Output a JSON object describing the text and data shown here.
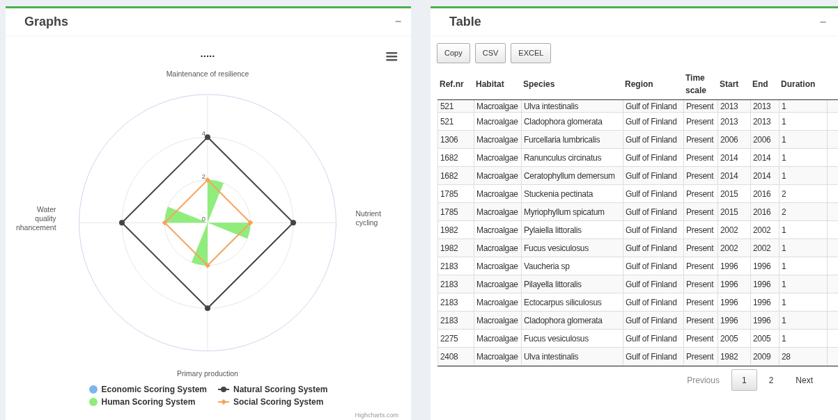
{
  "graphs_panel": {
    "title": "Graphs",
    "collapse": "−",
    "chart": {
      "title": ".....",
      "axis_labels": [
        "Maintenance of resilience",
        "Nutrient cycling",
        "Primary production",
        "Water quality nhancement"
      ],
      "tick_labels": [
        "4",
        "2",
        "0"
      ],
      "legend": [
        {
          "name": "Economic Scoring System",
          "color": "#7cb5ec",
          "kind": "dot"
        },
        {
          "name": "Natural Scoring System",
          "color": "#434348",
          "kind": "line-circle"
        },
        {
          "name": "Human Scoring System",
          "color": "#90ed7d",
          "kind": "dot"
        },
        {
          "name": "Social Scoring System",
          "color": "#f7a35c",
          "kind": "line-diamond"
        }
      ]
    },
    "credit": "Highcharts.com"
  },
  "table_panel": {
    "title": "Table",
    "collapse": "−",
    "buttons": [
      "Copy",
      "CSV",
      "EXCEL"
    ],
    "columns": [
      "Ref.nr",
      "Habitat",
      "Species",
      "Region",
      "Time scale",
      "Start",
      "End",
      "Duration"
    ],
    "rows": [
      [
        "521",
        "Macroalgae",
        "Ulva intestinalis",
        "Gulf of Finland",
        "Present",
        "2013",
        "2013",
        "1"
      ],
      [
        "521",
        "Macroalgae",
        "Cladophora glomerata",
        "Gulf of Finland",
        "Present",
        "2013",
        "2013",
        "1"
      ],
      [
        "1306",
        "Macroalgae",
        "Furcellaria lumbricalis",
        "Gulf of Finland",
        "Present",
        "2006",
        "2006",
        "1"
      ],
      [
        "1682",
        "Macroalgae",
        "Ranunculus circinatus",
        "Gulf of Finland",
        "Present",
        "2014",
        "2014",
        "1"
      ],
      [
        "1682",
        "Macroalgae",
        "Ceratophyllum demersum",
        "Gulf of Finland",
        "Present",
        "2014",
        "2014",
        "1"
      ],
      [
        "1785",
        "Macroalgae",
        "Stuckenia pectinata",
        "Gulf of Finland",
        "Present",
        "2015",
        "2016",
        "2"
      ],
      [
        "1785",
        "Macroalgae",
        "Myriophyllum spicatum",
        "Gulf of Finland",
        "Present",
        "2015",
        "2016",
        "2"
      ],
      [
        "1982",
        "Macroalgae",
        "Pylaiella littoralis",
        "Gulf of Finland",
        "Present",
        "2002",
        "2002",
        "1"
      ],
      [
        "1982",
        "Macroalgae",
        "Fucus vesiculosus",
        "Gulf of Finland",
        "Present",
        "2002",
        "2002",
        "1"
      ],
      [
        "2183",
        "Macroalgae",
        "Vaucheria sp",
        "Gulf of Finland",
        "Present",
        "1996",
        "1996",
        "1"
      ],
      [
        "2183",
        "Macroalgae",
        "Pilayella littoralis",
        "Gulf of Finland",
        "Present",
        "1996",
        "1996",
        "1"
      ],
      [
        "2183",
        "Macroalgae",
        "Ectocarpus siliculosus",
        "Gulf of Finland",
        "Present",
        "1996",
        "1996",
        "1"
      ],
      [
        "2183",
        "Macroalgae",
        "Cladophora glomerata",
        "Gulf of Finland",
        "Present",
        "1996",
        "1996",
        "1"
      ],
      [
        "2275",
        "Macroalgae",
        "Fucus vesiculosus",
        "Gulf of Finland",
        "Present",
        "2005",
        "2005",
        "1"
      ],
      [
        "2408",
        "Macroalgae",
        "Ulva intestinalis",
        "Gulf of Finland",
        "Present",
        "1982",
        "2009",
        "28"
      ]
    ],
    "pagination": [
      {
        "label": "Previous",
        "disabled": true,
        "selected": false
      },
      {
        "label": "1",
        "disabled": false,
        "selected": true
      },
      {
        "label": "2",
        "disabled": false,
        "selected": false
      },
      {
        "label": "Next",
        "disabled": false,
        "selected": false
      }
    ]
  }
}
